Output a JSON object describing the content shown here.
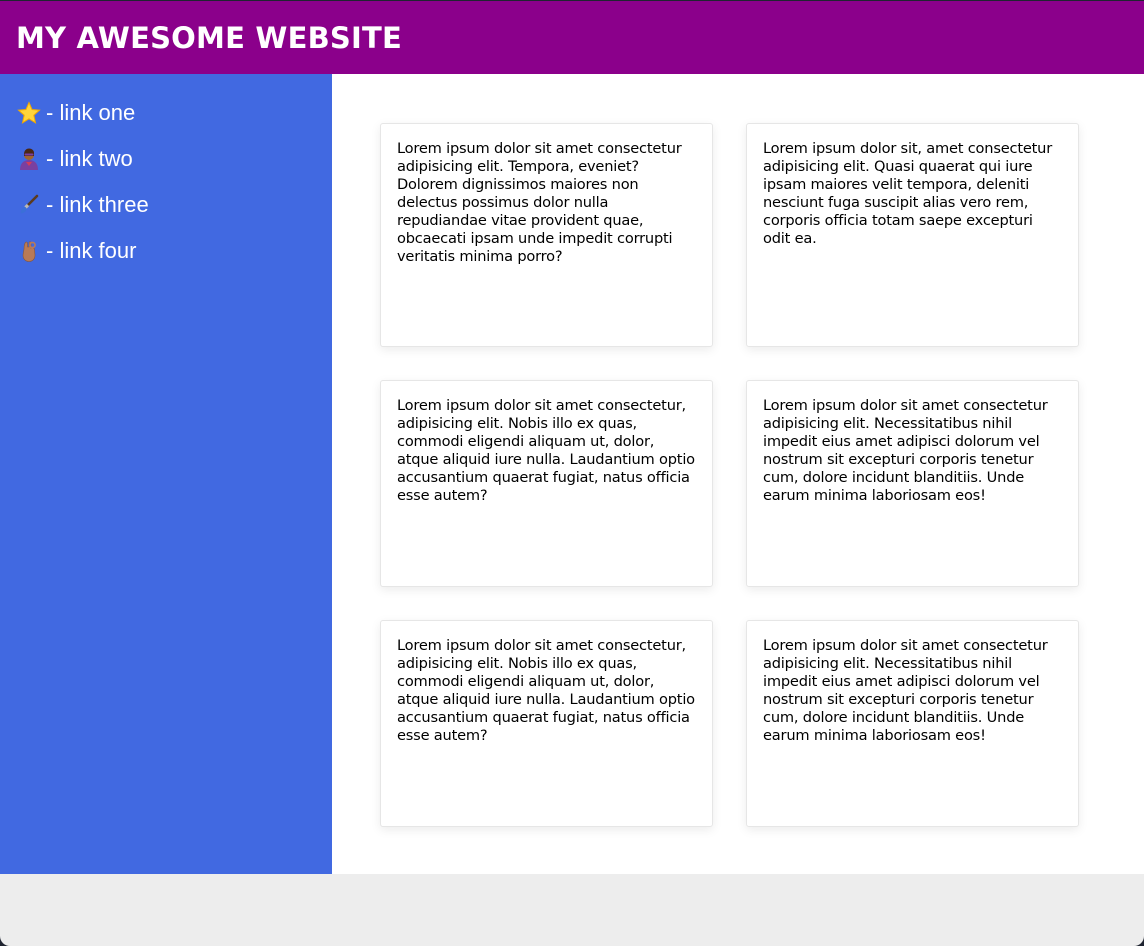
{
  "header": {
    "title": "MY AWESOME WEBSITE"
  },
  "sidebar": {
    "items": [
      {
        "icon": "star-icon",
        "label": "- link one"
      },
      {
        "icon": "superhero-icon",
        "label": "- link two"
      },
      {
        "icon": "paintbrush-icon",
        "label": "- link three"
      },
      {
        "icon": "ok-hand-icon",
        "label": "- link four"
      }
    ]
  },
  "cards": [
    {
      "text": "Lorem ipsum dolor sit amet consectetur adipisicing elit. Tempora, eveniet? Dolorem dignissimos maiores non delectus possimus dolor nulla repudiandae vitae provident quae, obcaecati ipsam unde impedit corrupti veritatis minima porro?"
    },
    {
      "text": "Lorem ipsum dolor sit, amet consectetur adipisicing elit. Quasi quaerat qui iure ipsam maiores velit tempora, deleniti nesciunt fuga suscipit alias vero rem, corporis officia totam saepe excepturi odit ea."
    },
    {
      "text": "Lorem ipsum dolor sit amet consectetur, adipisicing elit. Nobis illo ex quas, commodi eligendi aliquam ut, dolor, atque aliquid iure nulla. Laudantium optio accusantium quaerat fugiat, natus officia esse autem?"
    },
    {
      "text": "Lorem ipsum dolor sit amet consectetur adipisicing elit. Necessitatibus nihil impedit eius amet adipisci dolorum vel nostrum sit excepturi corporis tenetur cum, dolore incidunt blanditiis. Unde earum minima laboriosam eos!"
    },
    {
      "text": "Lorem ipsum dolor sit amet consectetur, adipisicing elit. Nobis illo ex quas, commodi eligendi aliquam ut, dolor, atque aliquid iure nulla. Laudantium optio accusantium quaerat fugiat, natus officia esse autem?"
    },
    {
      "text": "Lorem ipsum dolor sit amet consectetur adipisicing elit. Necessitatibus nihil impedit eius amet adipisci dolorum vel nostrum sit excepturi corporis tenetur cum, dolore incidunt blanditiis. Unde earum minima laboriosam eos!"
    }
  ],
  "colors": {
    "header_bg": "#8b008b",
    "sidebar_bg": "#4169e1",
    "main_bg": "#ffffff",
    "footer_bg": "#ededed"
  }
}
